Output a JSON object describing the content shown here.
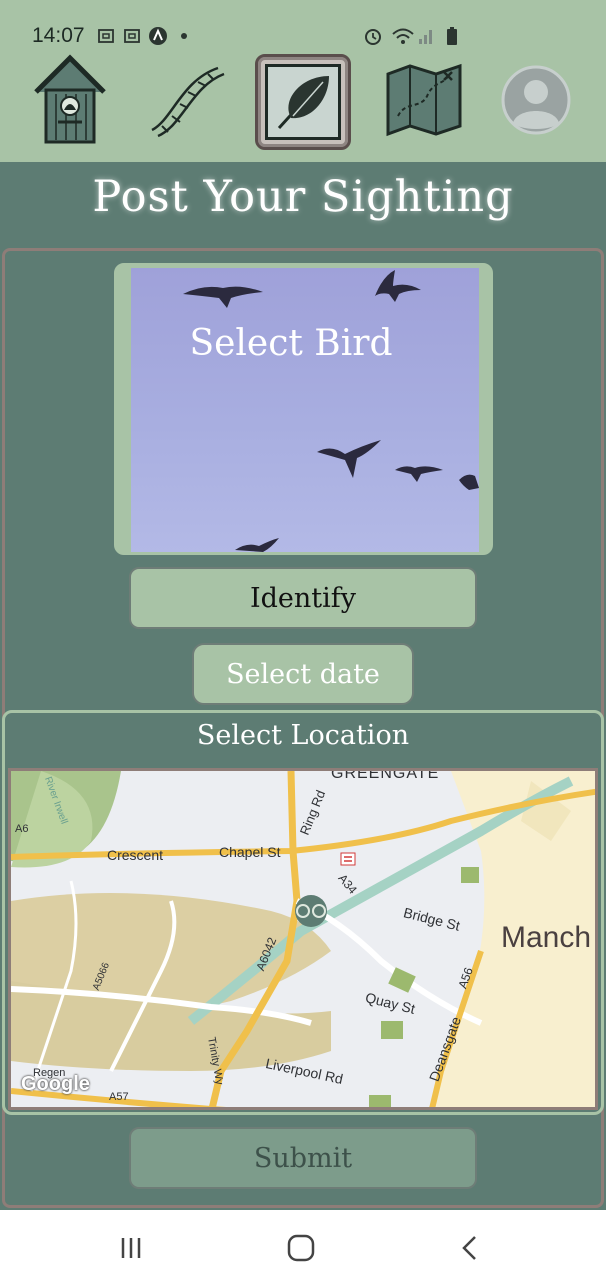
{
  "status_bar": {
    "time": "14:07",
    "icons": [
      "screenshot-icon",
      "screenshot-icon",
      "app-icon",
      "dot-icon",
      "alarm-icon",
      "wifi-icon",
      "signal-icon",
      "battery-icon"
    ]
  },
  "nav": {
    "items": [
      {
        "icon": "birdhouse-icon"
      },
      {
        "icon": "dna-icon"
      },
      {
        "icon": "feather-icon",
        "active": true
      },
      {
        "icon": "map-icon"
      },
      {
        "icon": "profile-icon"
      }
    ]
  },
  "page": {
    "title": "Post Your Sighting"
  },
  "bird": {
    "select_label": "Select Bird"
  },
  "buttons": {
    "identify": "Identify",
    "select_date": "Select date",
    "submit": "Submit"
  },
  "location": {
    "title": "Select Location",
    "map_labels": {
      "greengate": "GREENGATE",
      "river_irwell": "River Irwell",
      "crescent": "Crescent",
      "chapel_st": "Chapel St",
      "ring_rd": "Ring Rd",
      "a6": "A6",
      "a34": "A34",
      "bridge_st": "Bridge St",
      "manchester": "Manch",
      "a6042": "A6042",
      "a5066": "A5066",
      "a56": "A56",
      "quay_st": "Quay St",
      "deansgate": "Deansgate",
      "trinity_wy": "Trinity Wy",
      "liverpool_rd": "Liverpool Rd",
      "regent": "Regen",
      "a57": "A57",
      "google": "Google"
    }
  },
  "colors": {
    "background": "#5d7c73",
    "nav_bg": "#a8c3a6",
    "button_bg": "#a8c3a6",
    "submit_bg": "#7d9c8b",
    "border_brown": "#8e7d78",
    "sky": "#a8aee0"
  }
}
